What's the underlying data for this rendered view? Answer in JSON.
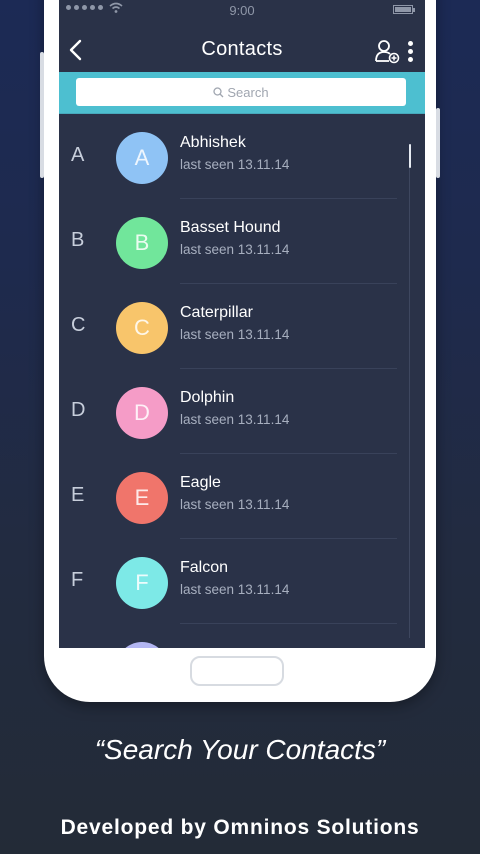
{
  "status_bar": {
    "time": "9:00"
  },
  "app_bar": {
    "title": "Contacts",
    "back_icon": "chevron-left-icon",
    "add_icon": "add-user-icon",
    "menu_icon": "more-vert-icon"
  },
  "search": {
    "placeholder": "Search",
    "icon": "search-icon",
    "accent": "#4dbfd0"
  },
  "contacts": [
    {
      "section": "A",
      "initial": "A",
      "name": "Abhishek",
      "last_seen": "last seen 13.11.14",
      "color": "#8fc3f5"
    },
    {
      "section": "B",
      "initial": "B",
      "name": "Basset Hound",
      "last_seen": "last seen 13.11.14",
      "color": "#71e69b"
    },
    {
      "section": "C",
      "initial": "C",
      "name": "Caterpillar",
      "last_seen": "last seen 13.11.14",
      "color": "#f8c56b"
    },
    {
      "section": "D",
      "initial": "D",
      "name": "Dolphin",
      "last_seen": "last seen 13.11.14",
      "color": "#f59cc7"
    },
    {
      "section": "E",
      "initial": "E",
      "name": "Eagle",
      "last_seen": "last seen 13.11.14",
      "color": "#f0756b"
    },
    {
      "section": "F",
      "initial": "F",
      "name": "Falcon",
      "last_seen": "last seen 13.11.14",
      "color": "#7de9e7"
    }
  ],
  "promo": {
    "tagline": "“Search Your Contacts”",
    "developer": "Developed by Omninos Solutions"
  }
}
